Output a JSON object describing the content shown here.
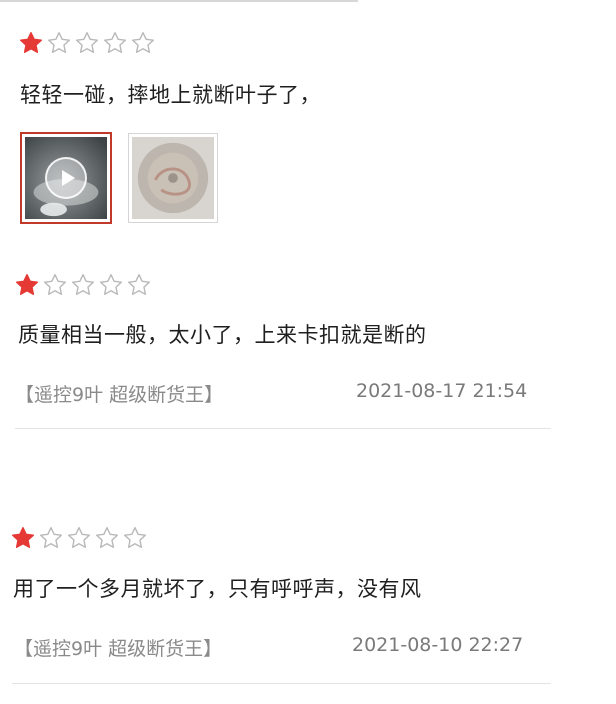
{
  "colors": {
    "star_filled": "#e53935",
    "star_empty": "#b9b9b9",
    "selected_border": "#c0392b"
  },
  "reviews": [
    {
      "rating": 1,
      "text": "轻轻一碰，摔地上就断叶子了，",
      "media": [
        {
          "type": "video",
          "icon": "play-icon"
        },
        {
          "type": "image"
        }
      ]
    },
    {
      "rating": 1,
      "text": "质量相当一般，太小了，上来卡扣就是断的",
      "spec": "【遥控9叶 超级断货王】",
      "date": "2021-08-17 21:54"
    },
    {
      "rating": 1,
      "text": "用了一个多月就坏了，只有呼呼声，没有风",
      "spec": "【遥控9叶 超级断货王】",
      "date": "2021-08-10 22:27"
    }
  ]
}
